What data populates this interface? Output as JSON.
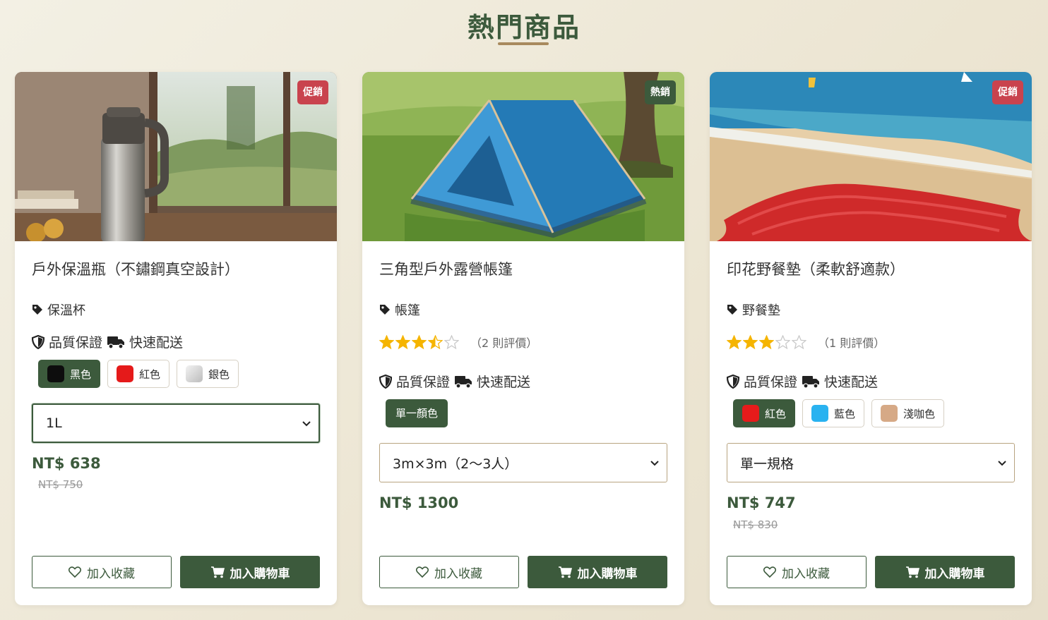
{
  "section": {
    "title": "熱門商品"
  },
  "colors": {
    "primary": "#3c5a3c",
    "sale_badge": "#c9434e",
    "accent_line": "#a88a5e",
    "star": "#f5b400"
  },
  "labels": {
    "quality": "品質保證",
    "shipping": "快速配送",
    "add_favorite": "加入收藏",
    "add_cart": "加入購物車"
  },
  "products": [
    {
      "badge": "促銷",
      "name": "戶外保溫瓶（不鏽鋼真空設計）",
      "category": "保溫杯",
      "colors": [
        {
          "label": "黑色",
          "swatch": "#0d0d0d",
          "selected": true
        },
        {
          "label": "紅色",
          "swatch": "#e51a1a",
          "selected": false
        },
        {
          "label": "銀色",
          "swatch": "#d9d9d9",
          "selected": false
        }
      ],
      "option": "1L",
      "price": "NT$ 638",
      "original_price": "NT$ 750"
    },
    {
      "badge": "熱銷",
      "name": "三角型戶外露營帳篷",
      "category": "帳篷",
      "rating": 3.5,
      "review_count": "（2 則評價）",
      "single_color": "單一顏色",
      "option": "3m×3m（2～3人）",
      "price": "NT$ 1300"
    },
    {
      "badge": "促銷",
      "name": "印花野餐墊（柔軟舒適款）",
      "category": "野餐墊",
      "rating": 3,
      "review_count": "（1 則評價）",
      "colors": [
        {
          "label": "紅色",
          "swatch": "#e61b1b",
          "selected": true
        },
        {
          "label": "藍色",
          "swatch": "#29b2f0",
          "selected": false
        },
        {
          "label": "淺咖色",
          "swatch": "#d6a986",
          "selected": false
        }
      ],
      "option": "單一規格",
      "price": "NT$ 747",
      "original_price": "NT$ 830"
    }
  ]
}
